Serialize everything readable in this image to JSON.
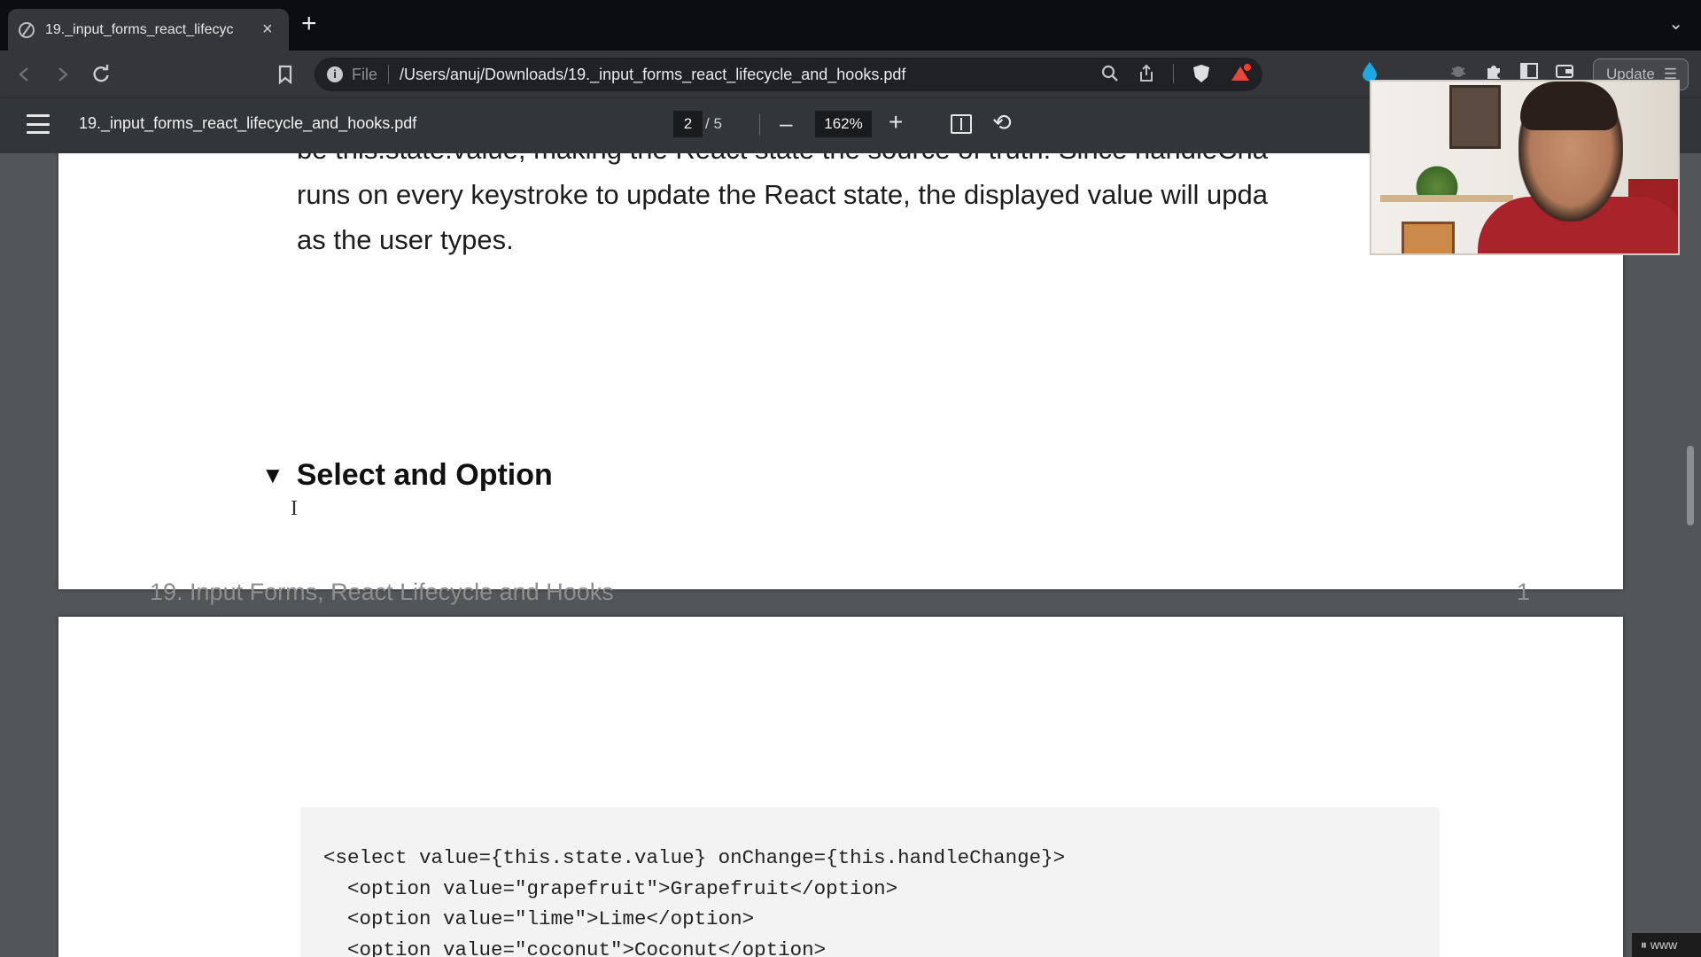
{
  "browser": {
    "tab_title": "19._input_forms_react_lifecyc",
    "tab_close": "×",
    "new_tab": "+",
    "tab_search": "⌄",
    "url_scheme": "File",
    "url": "/Users/anuj/Downloads/19._input_forms_react_lifecycle_and_hooks.pdf",
    "update_label": "Update"
  },
  "pdf_toolbar": {
    "title": "19._input_forms_react_lifecycle_and_hooks.pdf",
    "current_page": "2",
    "total_pages": "/ 5",
    "zoom": "162%",
    "zoom_out": "–",
    "zoom_in": "+"
  },
  "page1": {
    "line_partial": "be this.state.value, making the React state the source of truth. Since handleCha",
    "line2": "runs on every keystroke to update the React state, the displayed value will upda",
    "line3": "as the user types.",
    "section_toggle": "▼",
    "section_heading": "Select and Option",
    "footer_title": "19. Input Forms, React Lifecycle and Hooks",
    "footer_page": "1"
  },
  "page2": {
    "code_lines": [
      "<select value={this.state.value} onChange={this.handleChange}>",
      "  <option value=\"grapefruit\">Grapefruit</option>",
      "  <option value=\"lime\">Lime</option>",
      "  <option value=\"coconut\">Coconut</option>"
    ]
  },
  "overlay": {
    "corner_text": "⏸ www"
  },
  "colors": {
    "tabstrip_bg": "#0b0d11",
    "toolbar_bg": "#35363a",
    "pdfbar_bg": "#323639",
    "viewer_bg": "#525659",
    "code_bg": "#f3f3f3"
  }
}
